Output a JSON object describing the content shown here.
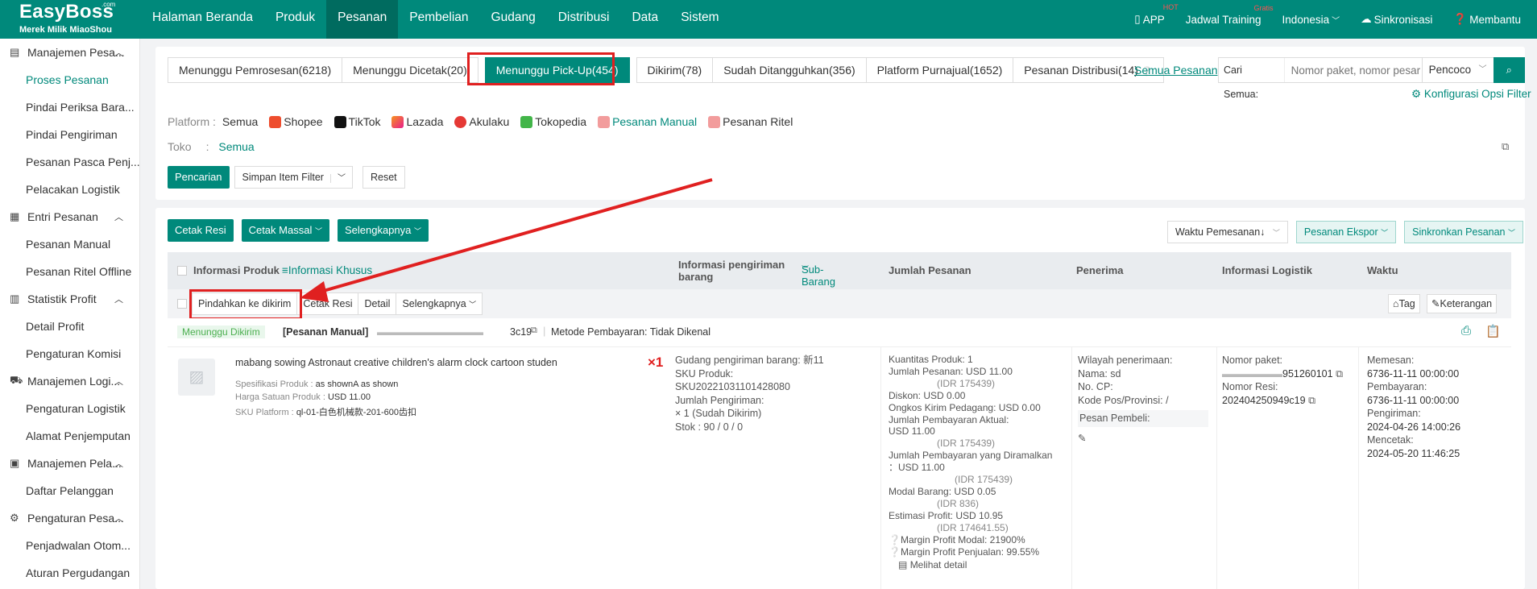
{
  "brand": {
    "logo": "EasyBoss",
    "com": ".com",
    "subtitle": "Merek Milik MiaoShou"
  },
  "nav": [
    "Halaman Beranda",
    "Produk",
    "Pesanan",
    "Pembelian",
    "Gudang",
    "Distribusi",
    "Data",
    "Sistem"
  ],
  "topright": {
    "app": "APP",
    "app_sup": "HOT",
    "training": "Jadwal Training",
    "training_sup": "Gratis",
    "lang": "Indonesia",
    "sync": "Sinkronisasi",
    "help": "Membantu"
  },
  "sidebar": [
    {
      "group": "Manajemen Pesa...",
      "items": [
        "Proses Pesanan",
        "Pindai Periksa Bara...",
        "Pindai Pengiriman",
        "Pesanan Pasca Penj...",
        "Pelacakan Logistik"
      ]
    },
    {
      "group": "Entri Pesanan",
      "items": [
        "Pesanan Manual",
        "Pesanan Ritel Offline"
      ]
    },
    {
      "group": "Statistik Profit",
      "items": [
        "Detail Profit",
        "Pengaturan Komisi"
      ]
    },
    {
      "group": "Manajemen Logi...",
      "items": [
        "Pengaturan Logistik",
        "Alamat Penjemputan"
      ]
    },
    {
      "group": "Manajemen Pela...",
      "items": [
        "Daftar Pelanggan"
      ]
    },
    {
      "group": "Pengaturan Pesa...",
      "items": [
        "Penjadwalan Otom...",
        "Aturan Pergudangan"
      ]
    }
  ],
  "tabs": [
    "Menunggu Pemrosesan(6218)",
    "Menunggu Dicetak(20)",
    "Menunggu Pick-Up(454)",
    "Dikirim(78)",
    "Sudah Ditangguhkan(356)",
    "Platform Purnajual(1652)",
    "Pesanan Distribusi(14)"
  ],
  "all_orders": "Semua Pesanan",
  "search": {
    "label": "Cari Semua:",
    "placeholder": "Nomor paket, nomor pesar",
    "mode": "Pencoco"
  },
  "filter_config": "Konfigurasi Opsi Filter",
  "platform": {
    "label": "Platform :",
    "items": [
      "Semua",
      "Shopee",
      "TikTok",
      "Lazada",
      "Akulaku",
      "Tokopedia",
      "Pesanan Manual",
      "Pesanan Ritel"
    ]
  },
  "store": {
    "label": "Toko",
    "value": "Semua"
  },
  "filter_buttons": {
    "search": "Pencarian",
    "save": "Simpan Item Filter",
    "reset": "Reset"
  },
  "actions": {
    "print": "Cetak Resi",
    "mass": "Cetak Massal",
    "more": "Selengkapnya",
    "sort": "Waktu Pemesanan↓",
    "export": "Pesanan Ekspor",
    "sync": "Sinkronkan Pesanan"
  },
  "thead": {
    "info": "Informasi Produk",
    "special": "≡Informasi Khusus",
    "ship1": "Informasi pengiriman",
    "ship2": "barang",
    "sub": "Sub-Barang",
    "qty": "Jumlah Pesanan",
    "recv": "Penerima",
    "logi": "Informasi Logistik",
    "time": "Waktu"
  },
  "rowtools": {
    "move": "Pindahkan ke dikirim",
    "print": "Cetak Resi",
    "detail": "Detail",
    "more": "Selengkapnya",
    "tag": "Tag",
    "note": "Keterangan"
  },
  "order": {
    "status": "Menunggu Dikirim",
    "type": "[Pesanan Manual]",
    "num_tail": "3c19",
    "payment": "Metode Pembayaran: Tidak Dikenal"
  },
  "product": {
    "title": "mabang sowing Astronaut creative children's alarm clock cartoon student astronaut...",
    "qty": "×1",
    "spec_label": "Spesifikasi Produk :",
    "spec": "as shownA as shown",
    "price_label": "Harga Satuan Produk :",
    "price": "USD 11.00",
    "sku_label": "SKU Platform :",
    "sku": "ql-01-白色机械款-201-600齿扣"
  },
  "ship": {
    "warehouse": "Gudang pengiriman barang:  新11",
    "sku": "SKU Produk:  SKU20221031101428080",
    "shipped_label": "Jumlah Pengiriman:",
    "shipped": "× 1 (Sudah Dikirim)",
    "stock": "Stok      :  90 / 0 / 0"
  },
  "amounts": [
    "Kuantitas Produk:  1",
    "Jumlah Pesanan:  USD 11.00",
    "(IDR 175439)",
    "Diskon:  USD 0.00",
    "Ongkos Kirim Pedagang:  USD 0.00",
    "Jumlah Pembayaran Aktual:",
    "USD 11.00",
    "(IDR 175439)",
    "Jumlah Pembayaran yang Diramalkan",
    "：USD 11.00",
    "(IDR 175439)",
    "Modal Barang:  USD 0.05",
    "(IDR 836)",
    "Estimasi Profit:  USD 10.95",
    "(IDR 174641.55)",
    "Margin Profit Modal:  21900%",
    "Margin Profit Penjualan:  99.55%",
    "Melihat detail"
  ],
  "receiver": [
    "Wilayah penerimaan:",
    "Nama:  sd",
    "No. CP:",
    "Kode Pos/Provinsi:  /",
    "Pesan Pembeli:"
  ],
  "logistics": {
    "pkg_label": "Nomor paket:",
    "pkg": "951260101",
    "resi_label": "Nomor Resi:",
    "resi": "202404250949c19"
  },
  "times": [
    "Memesan:",
    "6736-11-11 00:00:00",
    "Pembayaran:",
    "6736-11-11 00:00:00",
    "Pengiriman:",
    "2024-04-26 14:00:26",
    "Mencetak:",
    "2024-05-20 11:46:25"
  ]
}
